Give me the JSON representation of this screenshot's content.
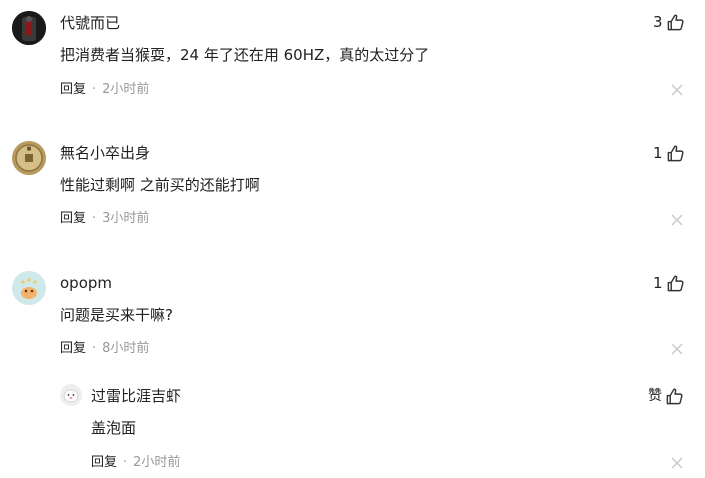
{
  "comments": [
    {
      "username": "代號而已",
      "text": "把消费者当猴耍，24 年了还在用 60HZ，真的太过分了",
      "reply_label": "回复",
      "separator": "·",
      "time": "2小时前",
      "likes": "3",
      "avatar_icon": "dark-figure-avatar"
    },
    {
      "username": "無名小卒出身",
      "text": "性能过剩啊 之前买的还能打啊",
      "reply_label": "回复",
      "separator": "·",
      "time": "3小时前",
      "likes": "1",
      "avatar_icon": "ancient-coin-avatar"
    },
    {
      "username": "opopm",
      "text": "问题是买来干嘛?",
      "reply_label": "回复",
      "separator": "·",
      "time": "8小时前",
      "likes": "1",
      "avatar_icon": "cartoon-bird-avatar",
      "replies": [
        {
          "username": "过雷比涯吉虾",
          "text": "盖泡面",
          "reply_label": "回复",
          "separator": "·",
          "time": "2小时前",
          "likes": "赞",
          "avatar_icon": "white-dog-avatar"
        }
      ]
    }
  ],
  "colors": {
    "text": "#222222",
    "muted": "#999999",
    "close": "#c8c8c8"
  },
  "icons": {
    "like": "thumbs-up-icon",
    "close": "close-icon"
  }
}
